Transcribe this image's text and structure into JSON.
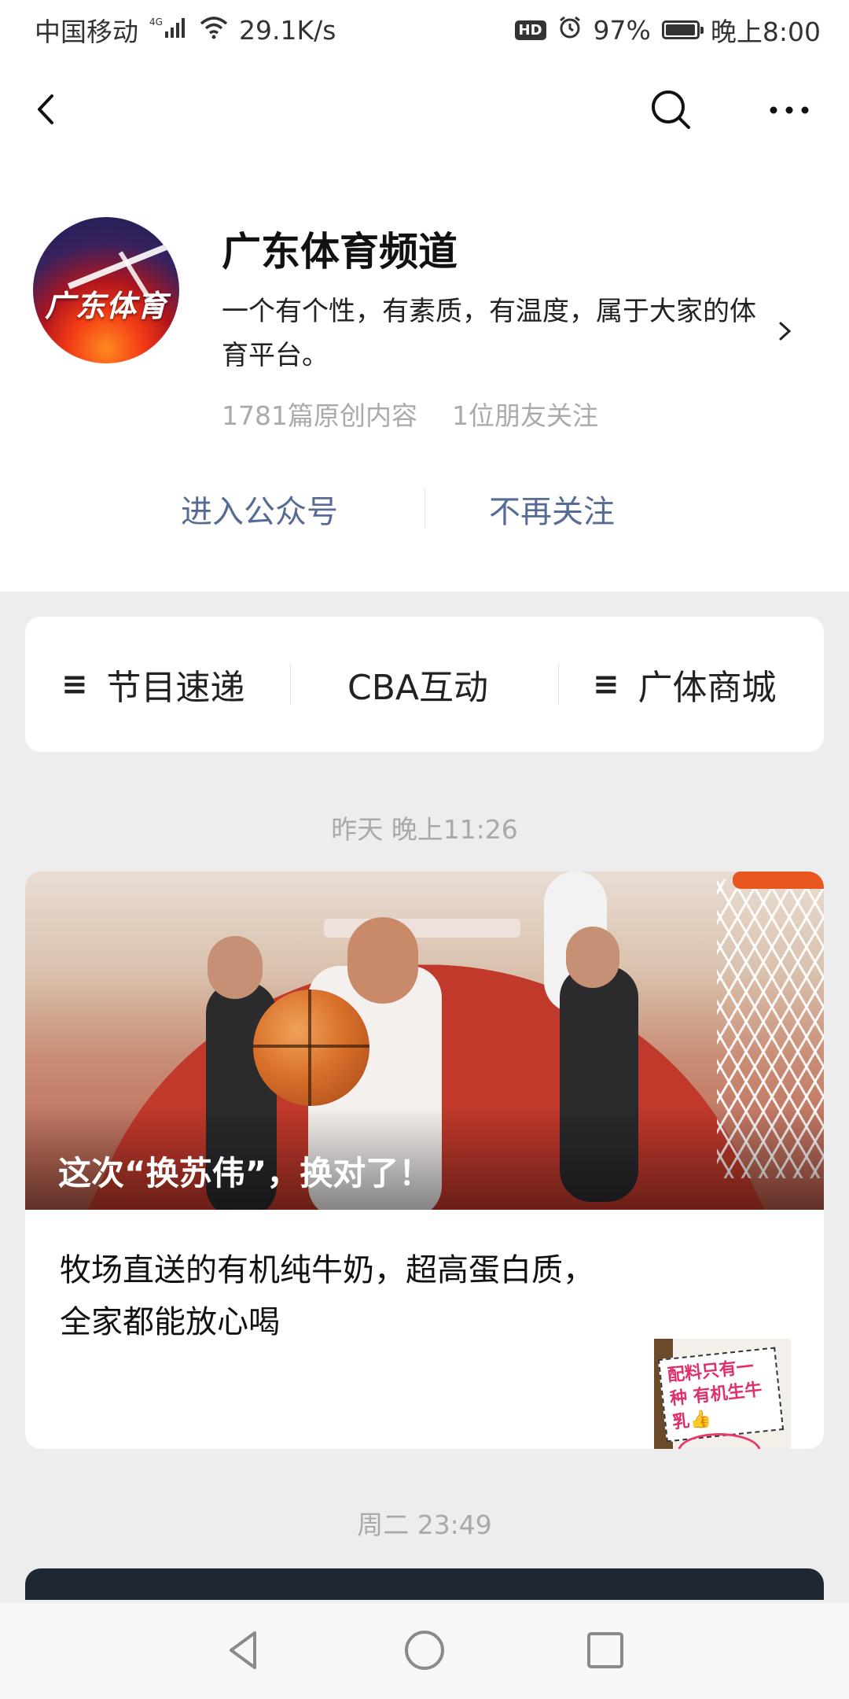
{
  "status_bar": {
    "carrier": "中国移动",
    "network": "4G",
    "speed": "29.1K/s",
    "hd": "HD",
    "battery_pct": "97%",
    "battery_level": 0.97,
    "time": "晚上8:00"
  },
  "top_nav": {
    "back_icon": "back-chevron-icon",
    "search_icon": "search-icon",
    "more_icon": "more-dots-icon"
  },
  "profile": {
    "avatar_text": "广东体育",
    "name": "广东体育频道",
    "description": "一个有个性，有素质，有温度，属于大家的体育平台。",
    "stats": {
      "original": "1781篇原创内容",
      "friends": "1位朋友关注"
    },
    "actions": {
      "enter": "进入公众号",
      "unfollow": "不再关注"
    },
    "link_color": "#566b95"
  },
  "menu": {
    "items": [
      {
        "label": "节目速递",
        "has_submenu": true
      },
      {
        "label": "CBA互动",
        "has_submenu": false
      },
      {
        "label": "广体商城",
        "has_submenu": true
      }
    ],
    "submenu_glyph": "≡"
  },
  "feed": {
    "groups": [
      {
        "date": "昨天 晚上11:26",
        "hero_title": "这次“换苏伟”，换对了！",
        "sub_article": "牧场直送的有机纯牛奶，超高蛋白质，全家都能放心喝",
        "thumb_text": "配料只有一种 有机生牛乳👍"
      },
      {
        "date": "周二 23:49"
      }
    ]
  },
  "nav_bar": {
    "back_icon": "nav-back-triangle-icon",
    "home_icon": "nav-home-circle-icon",
    "recents_icon": "nav-recents-square-icon"
  }
}
